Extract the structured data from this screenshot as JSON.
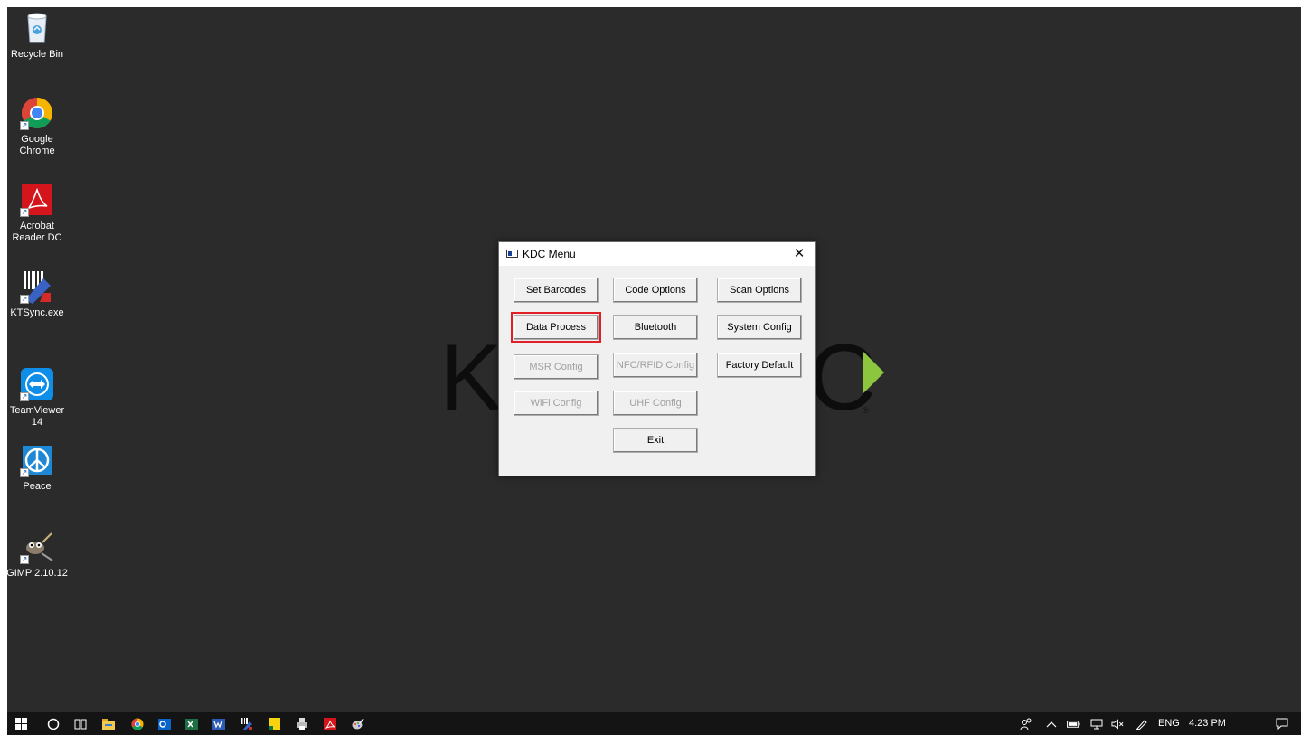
{
  "desktop": {
    "icons": [
      {
        "label": "Recycle Bin",
        "icon": "recycle-bin-icon"
      },
      {
        "label": "Google Chrome",
        "icon": "chrome-icon"
      },
      {
        "label": "Acrobat Reader DC",
        "icon": "acrobat-icon"
      },
      {
        "label": "KTSync.exe",
        "icon": "ktsync-icon"
      },
      {
        "label": "TeamViewer 14",
        "icon": "teamviewer-icon"
      },
      {
        "label": "Peace",
        "icon": "peace-icon"
      },
      {
        "label": "GIMP 2.10.12",
        "icon": "gimp-icon"
      }
    ],
    "wallpaper": {
      "left_text": "K",
      "right_text": "C",
      "reg_mark": "®",
      "accent": "#8cc63f"
    }
  },
  "dialog": {
    "title": "KDC Menu",
    "close_glyph": "✕",
    "buttons": [
      {
        "label": "Set Barcodes",
        "enabled": true
      },
      {
        "label": "Code Options",
        "enabled": true
      },
      {
        "label": "Scan Options",
        "enabled": true
      },
      {
        "label": "Data Process",
        "enabled": true,
        "highlighted": true
      },
      {
        "label": "Bluetooth",
        "enabled": true
      },
      {
        "label": "System Config",
        "enabled": true
      },
      {
        "label": "MSR Config",
        "enabled": false
      },
      {
        "label": "NFC/RFID Config",
        "enabled": false
      },
      {
        "label": "Factory Default",
        "enabled": true
      },
      {
        "label": "WiFi Config",
        "enabled": false
      },
      {
        "label": "UHF Config",
        "enabled": false
      },
      {
        "label": "Exit",
        "enabled": true
      }
    ],
    "highlight_color": "#e01f26"
  },
  "taskbar": {
    "apps": [
      "windows-start-icon",
      "search-circle-icon",
      "task-view-icon",
      "file-explorer-icon",
      "chrome-icon",
      "outlook-icon",
      "excel-icon",
      "word-icon",
      "ktsync-icon",
      "sticky-notes-icon",
      "printer-icon",
      "acrobat-icon",
      "paint-icon"
    ],
    "tray": {
      "language": "ENG",
      "time": "4:23 PM"
    }
  }
}
